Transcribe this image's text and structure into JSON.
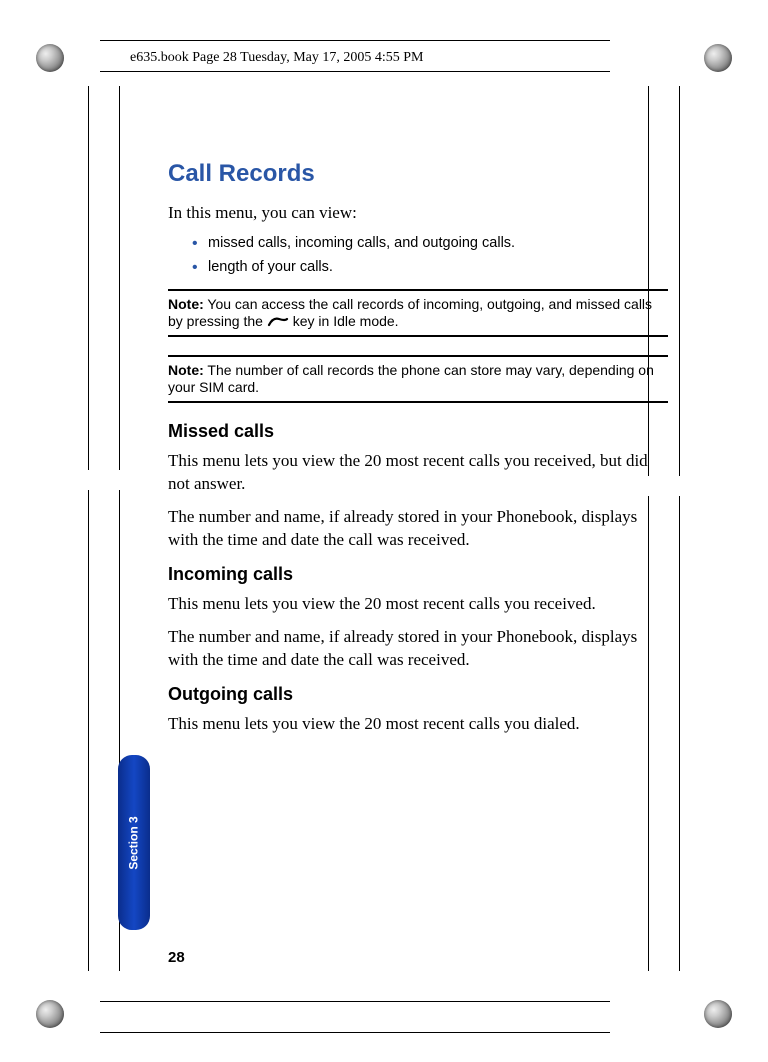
{
  "header": {
    "file_info": "e635.book  Page 28  Tuesday, May 17, 2005  4:55 PM"
  },
  "heading": "Call Records",
  "intro": "In this menu, you can view:",
  "bullets": [
    "missed calls, incoming calls, and outgoing calls.",
    "length of your calls."
  ],
  "note1": {
    "label": "Note:",
    "before_icon": " You can access the call records of incoming, outgoing, and missed calls by pressing the ",
    "after_icon": " key in Idle mode."
  },
  "note2": {
    "label": "Note:",
    "text": " The number of call records the phone can store may vary, depending on your SIM card."
  },
  "sections": {
    "missed": {
      "heading": "Missed calls",
      "p1": "This menu lets you view the 20 most recent calls you received, but did not answer.",
      "p2": "The number and name, if already stored in your Phonebook, displays with the time and date the call was received."
    },
    "incoming": {
      "heading": "Incoming calls",
      "p1": "This menu lets you view the 20 most recent calls you received.",
      "p2": "The number and name, if already stored in your Phonebook, displays with the time and date the call was received."
    },
    "outgoing": {
      "heading": "Outgoing calls",
      "p1": "This menu lets you view the 20 most recent calls you dialed."
    }
  },
  "section_tab": "Section 3",
  "page_number": "28"
}
